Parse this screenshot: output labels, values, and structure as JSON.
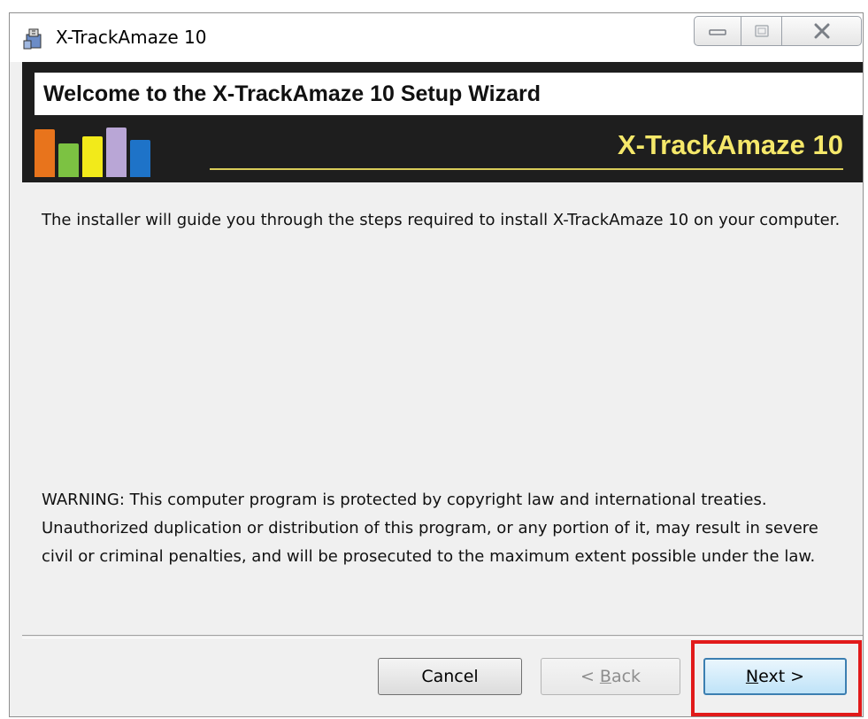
{
  "window": {
    "title": "X-TrackAmaze 10"
  },
  "banner": {
    "heading": "Welcome to the X-TrackAmaze 10 Setup Wizard",
    "brand": "X-TrackAmaze 10",
    "logo_colors": [
      "#e8741c",
      "#7cc242",
      "#f2ea1a",
      "#b9a6d6",
      "#1e73c8"
    ]
  },
  "content": {
    "intro": "The installer will guide you through the steps required to install X-TrackAmaze 10 on your computer.",
    "warning": "WARNING: This computer program is protected by copyright law and international treaties. Unauthorized duplication or distribution of this program, or any portion of it, may result in severe civil or criminal penalties, and will be prosecuted to the maximum extent possible under the law."
  },
  "buttons": {
    "cancel": "Cancel",
    "back_prefix": "< ",
    "back_key": "B",
    "back_rest": "ack",
    "next_key": "N",
    "next_rest": "ext >"
  },
  "colors": {
    "highlight": "#e11a1a",
    "banner_bg": "#1e1e1e",
    "brand_text": "#f5e86a"
  }
}
